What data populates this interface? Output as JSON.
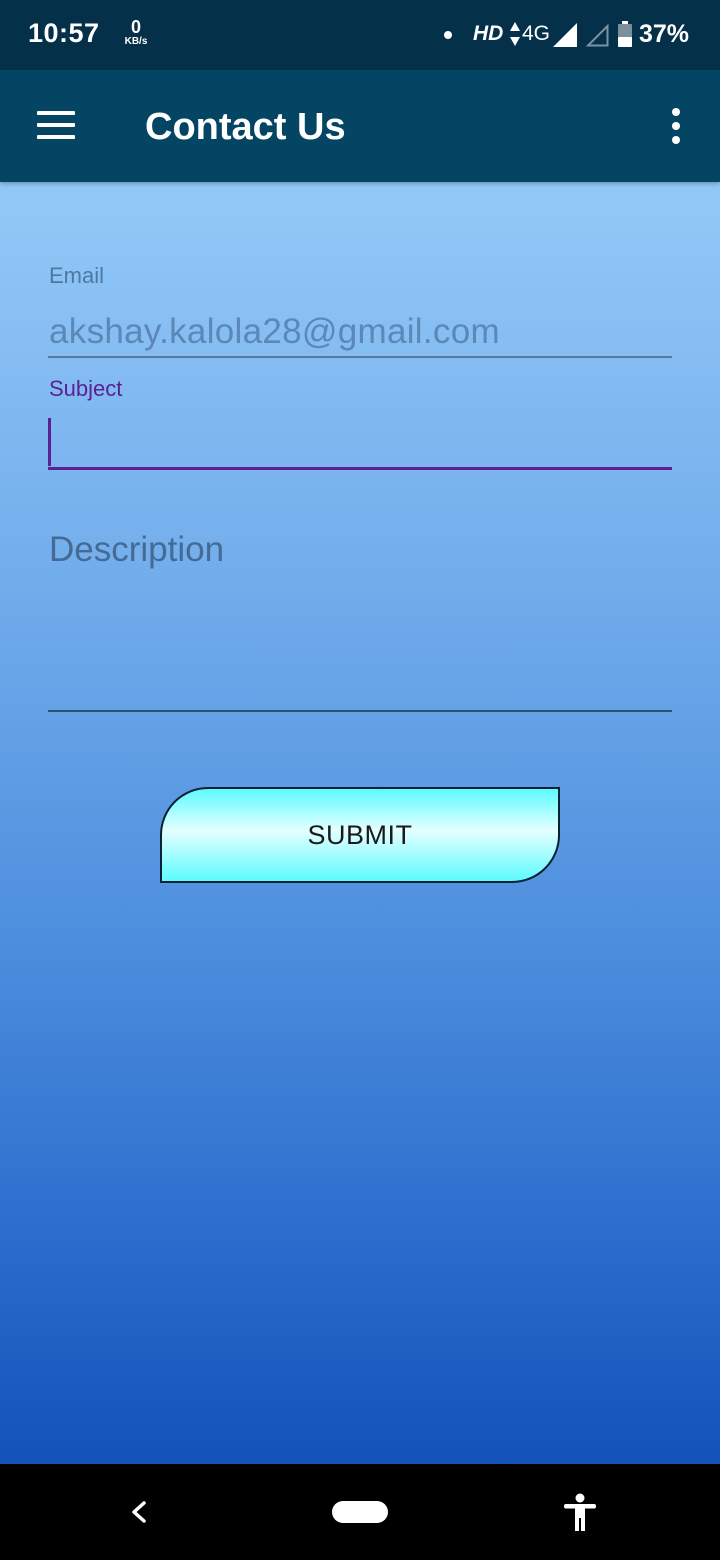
{
  "status_bar": {
    "time": "10:57",
    "net_speed_value": "0",
    "net_speed_unit": "KB/s",
    "hd_label": "HD",
    "network_type": "4G",
    "battery_percent": "37%",
    "icons": [
      "notification-dot-icon",
      "data-arrows-icon",
      "signal-full-icon",
      "signal-empty-icon",
      "battery-icon"
    ]
  },
  "app_bar": {
    "title": "Contact Us",
    "icons": [
      "hamburger-menu-icon",
      "overflow-menu-icon"
    ],
    "color": "#044563"
  },
  "form": {
    "email_label": "Email",
    "email_value": "akshay.kalola28@gmail.com",
    "subject_label": "Subject",
    "subject_value": "",
    "description_placeholder": "Description",
    "submit_label": "SUBMIT",
    "accent_color": "#5e1f93"
  },
  "nav_bar": {
    "icons": [
      "back-icon",
      "home-pill-icon",
      "accessibility-icon"
    ]
  }
}
